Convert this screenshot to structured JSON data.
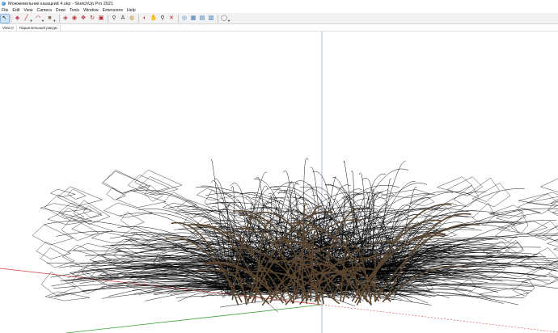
{
  "window": {
    "title": "Можжевельник казацкий 4.skp - SketchUp Pro 2021",
    "app_icon": "sketchup-icon"
  },
  "menu": {
    "items": [
      "File",
      "Edit",
      "View",
      "Camera",
      "Draw",
      "Tools",
      "Window",
      "Extensions",
      "Help"
    ]
  },
  "toolbar": {
    "tools": [
      {
        "name": "select-tool-icon",
        "glyph": "↖",
        "color": "#222222",
        "active": true
      },
      {
        "name": "eraser-tool-icon",
        "glyph": "◆",
        "color": "#d0506a"
      },
      {
        "name": "line-tool-icon",
        "glyph": "╱",
        "color": "#b01b1b",
        "dropdown": true
      },
      {
        "name": "arc-tool-icon",
        "glyph": "◠",
        "color": "#b01b1b",
        "dropdown": true
      },
      {
        "name": "rectangle-tool-icon",
        "glyph": "■",
        "color": "#8a6a4a",
        "dropdown": true
      },
      {
        "name": "push-pull-tool-icon",
        "glyph": "◈",
        "color": "#b03030"
      },
      {
        "name": "offset-tool-icon",
        "glyph": "◉",
        "color": "#c03030"
      },
      {
        "name": "move-tool-icon",
        "glyph": "✥",
        "color": "#c02020"
      },
      {
        "name": "rotate-tool-icon",
        "glyph": "↻",
        "color": "#c02020"
      },
      {
        "name": "scale-tool-icon",
        "glyph": "▣",
        "color": "#b02020"
      },
      {
        "name": "tape-measure-tool-icon",
        "glyph": "⚲",
        "color": "#444444"
      },
      {
        "name": "text-tool-icon",
        "glyph": "A",
        "color": "#333333"
      },
      {
        "name": "paint-bucket-tool-icon",
        "glyph": "◍",
        "color": "#c08a20"
      },
      {
        "name": "orbit-tool-icon",
        "glyph": "◐",
        "color": "#c04020"
      },
      {
        "name": "pan-tool-icon",
        "glyph": "✋",
        "color": "#c08a40"
      },
      {
        "name": "zoom-tool-icon",
        "glyph": "⚲",
        "color": "#333333"
      },
      {
        "name": "zoom-extents-tool-icon",
        "glyph": "✕",
        "color": "#b02020"
      },
      {
        "name": "3d-warehouse-icon",
        "glyph": "◎",
        "color": "#2a7fc4"
      },
      {
        "name": "extension-warehouse-icon",
        "glyph": "▦",
        "color": "#2a6fb0"
      },
      {
        "name": "layout-icon",
        "glyph": "▤",
        "color": "#2a6fb0"
      },
      {
        "name": "extension-manager-icon",
        "glyph": "▧",
        "color": "#2a6fb0"
      },
      {
        "name": "account-icon",
        "glyph": "◯",
        "color": "#555555",
        "dropdown": true
      }
    ]
  },
  "scenes": {
    "tabs": [
      "View 0",
      "Параллельный ракурс"
    ]
  },
  "viewport": {
    "axis_colors": {
      "red": "#d84040",
      "green": "#3aa03a",
      "blue": "#9aa8c8"
    }
  }
}
